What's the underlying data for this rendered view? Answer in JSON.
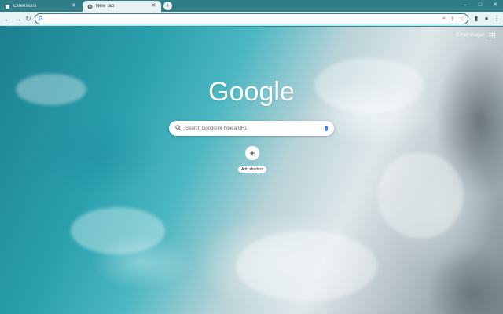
{
  "tabs": [
    {
      "label": "Extensions",
      "active": false,
      "icon": "puzzle-icon"
    },
    {
      "label": "New Tab",
      "active": true,
      "icon": "chrome-icon"
    }
  ],
  "window_controls": {
    "minimize": "–",
    "maximize": "□",
    "close": "✕",
    "new_tab": "+",
    "tab_close": "✕"
  },
  "nav": {
    "back": "←",
    "forward": "→",
    "reload": "↻"
  },
  "omnibox": {
    "value": "",
    "prefix": "G"
  },
  "toolbar_icons": {
    "zoom": "⌕",
    "share": "⇪",
    "bookmark": "☆",
    "sidebar": "▮",
    "profile": "●",
    "menu": "⋮"
  },
  "page": {
    "gmail": "Gmail",
    "images": "Images",
    "logo": "Google",
    "search_placeholder": "Search Google or type a URL",
    "add_shortcut": "Add shortcut",
    "add_icon": "+"
  },
  "colors": {
    "accent": "#2f7d86",
    "toolbar": "#e6f2f3"
  }
}
